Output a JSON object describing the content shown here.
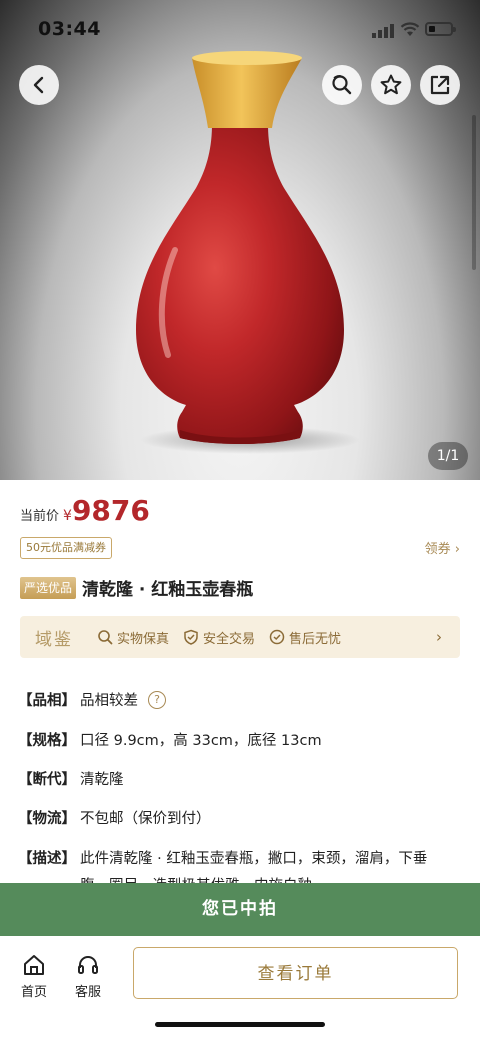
{
  "status": {
    "time": "03:44"
  },
  "gallery": {
    "page_indicator": "1/1"
  },
  "price": {
    "label": "当前价",
    "currency": "¥",
    "amount": "9876"
  },
  "coupon": {
    "tag": "50元优品满减券",
    "claim": "领券 ›"
  },
  "product": {
    "badge": "严选优品",
    "title": "清乾隆 · 红釉玉壶春瓶"
  },
  "guarantee": {
    "brand": "域鉴",
    "items": [
      "实物保真",
      "安全交易",
      "售后无忧"
    ],
    "chevron": "›"
  },
  "specs": [
    {
      "key": "【品相】",
      "value": "品相较差",
      "help": "?"
    },
    {
      "key": "【规格】",
      "value": "口径 9.9cm，高 33cm，底径 13cm"
    },
    {
      "key": "【断代】",
      "value": "清乾隆"
    },
    {
      "key": "【物流】",
      "value": "不包邮（保价到付）"
    },
    {
      "key": "【描述】",
      "value": "此件清乾隆 · 红釉玉壶春瓶，撇口，束颈，溜肩，下垂腹，圈足，造型极其优雅，内施白釉"
    }
  ],
  "banner": {
    "text": "您已中拍"
  },
  "bottom_nav": {
    "home": "首页",
    "service": "客服",
    "order_button": "查看订单"
  },
  "colors": {
    "price_red": "#b3272b",
    "gold": "#c9a86a",
    "won_green": "#558b5b",
    "vase_red": "#b51f22"
  },
  "icons": [
    "back-icon",
    "search-icon",
    "star-icon",
    "share-icon",
    "home-icon",
    "headset-icon"
  ]
}
